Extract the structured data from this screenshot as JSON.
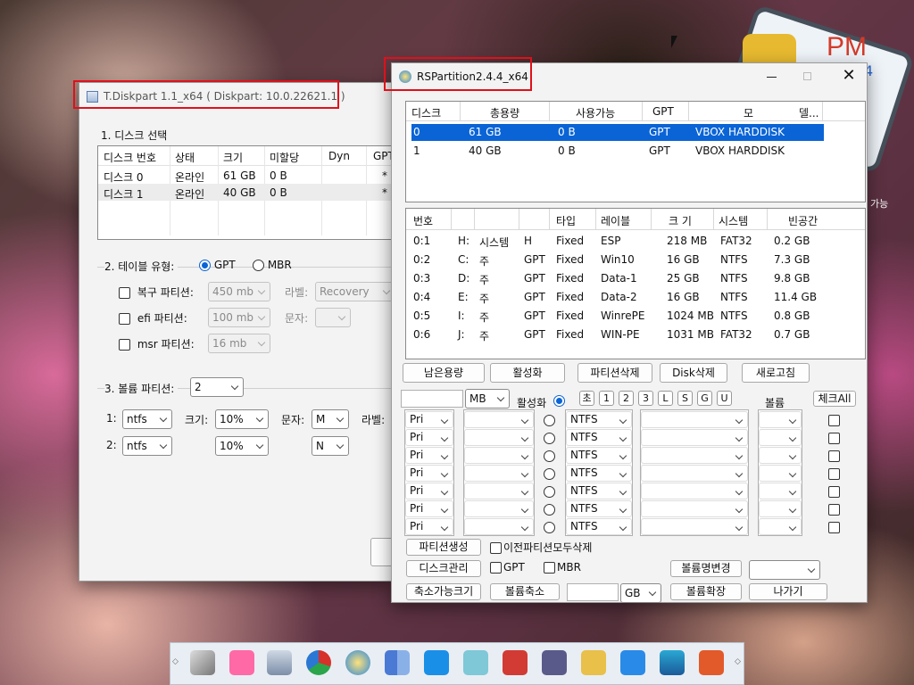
{
  "desktop": {
    "pm_logo_text": "PM",
    "pm_logo_sub": "4",
    "side_text": "가능"
  },
  "tdisk": {
    "title": "T.Diskpart 1.1_x64 ( Diskpart: 10.0.22621.1 )",
    "sec1": "1. 디스크 선택",
    "cols": [
      "디스크 번호",
      "상태",
      "크기",
      "미할당",
      "Dyn",
      "GPT"
    ],
    "rows": [
      [
        "디스크 0",
        "온라인",
        "61 GB",
        "0 B",
        "",
        "*"
      ],
      [
        "디스크 1",
        "온라인",
        "40 GB",
        "0 B",
        "",
        "*"
      ]
    ],
    "sec2": "2. 테이블 유형:",
    "gpt": "GPT",
    "mbr": "MBR",
    "recovery_label": "복구 파티션:",
    "recovery_size": "450 mb",
    "label_label": "라벨:",
    "recovery_name": "Recovery",
    "efi_label": "efi 파티션:",
    "efi_size": "100 mb",
    "letter_label": "문자:",
    "msr_label": "msr 파티션:",
    "msr_size": "16 mb",
    "sec3": "3. 볼륨 파티션:",
    "vol_count": "2",
    "v1": {
      "idx": "1:",
      "fs": "ntfs",
      "size_label": "크기:",
      "size": "10%",
      "letter_label": "문자:",
      "letter": "M",
      "label_label": "라벨:"
    },
    "v2": {
      "idx": "2:",
      "fs": "ntfs",
      "size": "10%",
      "letter": "N"
    }
  },
  "rsp": {
    "title": "RSPartition2.4.4_x64",
    "disk_cols": [
      "디스크",
      "총용량",
      "사용가능",
      "GPT",
      "모",
      "델..."
    ],
    "disks": [
      [
        "0",
        "61 GB",
        "0 B",
        "GPT",
        "VBOX HARDDISK"
      ],
      [
        "1",
        "40 GB",
        "0 B",
        "GPT",
        "VBOX HARDDISK"
      ]
    ],
    "part_cols": [
      "번호",
      "",
      "",
      "",
      "타입",
      "레이블",
      "크 기",
      "시스템",
      "빈공간"
    ],
    "parts": [
      [
        "0:1",
        "H:",
        "시스템",
        "H",
        "Fixed",
        "ESP",
        "218 MB",
        "FAT32",
        "0.2 GB"
      ],
      [
        "0:2",
        "C:",
        "주",
        "GPT",
        "Fixed",
        "Win10",
        "16 GB",
        "NTFS",
        "7.3 GB"
      ],
      [
        "0:3",
        "D:",
        "주",
        "GPT",
        "Fixed",
        "Data-1",
        "25 GB",
        "NTFS",
        "9.8 GB"
      ],
      [
        "0:4",
        "E:",
        "주",
        "GPT",
        "Fixed",
        "Data-2",
        "16 GB",
        "NTFS",
        "11.4 GB"
      ],
      [
        "0:5",
        "I:",
        "주",
        "GPT",
        "Fixed",
        "WinrePE",
        "1024 MB",
        "NTFS",
        "0.8 GB"
      ],
      [
        "0:6",
        "J:",
        "주",
        "GPT",
        "Fixed",
        "WIN-PE",
        "1031 MB",
        "FAT32",
        "0.7 GB"
      ]
    ],
    "btns": [
      "남은용량",
      "활성화",
      "파티션삭제",
      "Disk삭제",
      "새로고침"
    ],
    "unit": "MB",
    "active_label": "활성화",
    "letters": [
      "초",
      "1",
      "2",
      "3",
      "L",
      "S",
      "G",
      "U"
    ],
    "vol_label": "볼륨",
    "checkall": "체크All",
    "type_val": "Pri",
    "fs_val": "NTFS",
    "create": "파티션생성",
    "delete_all": "이전파티션모두삭제",
    "diskmgmt": "디스크관리",
    "gpt": "GPT",
    "mbr": "MBR",
    "rename": "볼륨명변경",
    "shrinkable": "축소가능크기",
    "shrink": "볼륨축소",
    "gb": "GB",
    "extend": "볼륨확장",
    "exit": "나가기"
  }
}
